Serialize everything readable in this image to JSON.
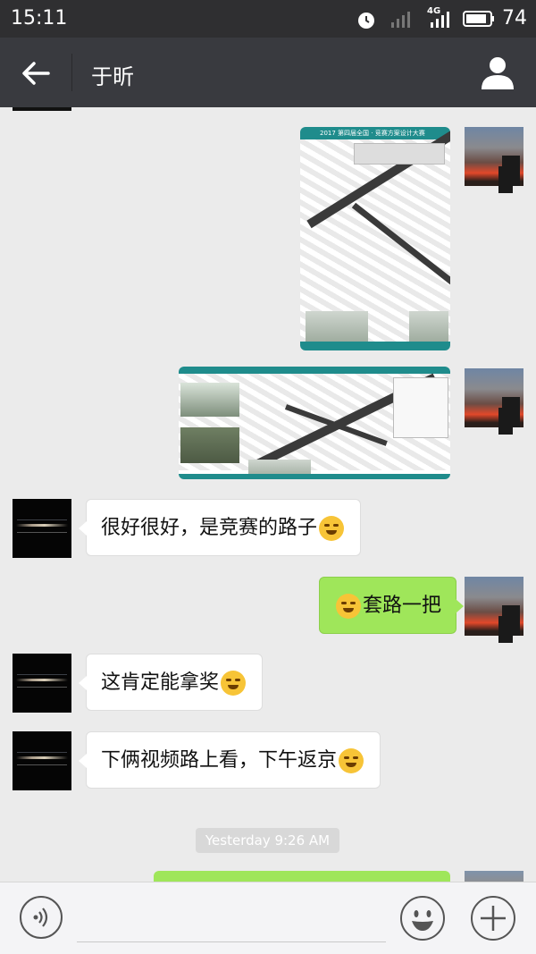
{
  "status_bar": {
    "time": "15:11",
    "network": "4G",
    "battery": "74"
  },
  "header": {
    "title": "于昕",
    "back_icon": "arrow-left-icon",
    "profile_icon": "person-icon"
  },
  "messages": [
    {
      "side": "right",
      "type": "image",
      "header_text": "2017 第四届全国 · 竞赛方案设计大赛"
    },
    {
      "side": "right",
      "type": "image"
    },
    {
      "side": "left",
      "type": "text",
      "text": "很好很好，是竞赛的路子",
      "emoji_after": "laughing-crying-emoji"
    },
    {
      "side": "right",
      "type": "text",
      "emoji_before": "laughing-crying-emoji",
      "text": "套路一把"
    },
    {
      "side": "left",
      "type": "text",
      "text": "这肯定能拿奖",
      "emoji_after": "smug-emoji"
    },
    {
      "side": "left",
      "type": "text",
      "text": "下俩视频路上看，下午返京",
      "emoji_after": "laughing-crying-emoji"
    }
  ],
  "timestamp": "Yesterday 9:26 AM",
  "input_bar": {
    "voice_icon": "voice-icon",
    "emoji_icon": "smiley-icon",
    "plus_icon": "plus-icon"
  },
  "colors": {
    "header_bg": "#393a3f",
    "chat_bg": "#ebebeb",
    "sent_bubble": "#9fe65a",
    "received_bubble": "#ffffff",
    "poster_accent": "#1f8c8c"
  }
}
